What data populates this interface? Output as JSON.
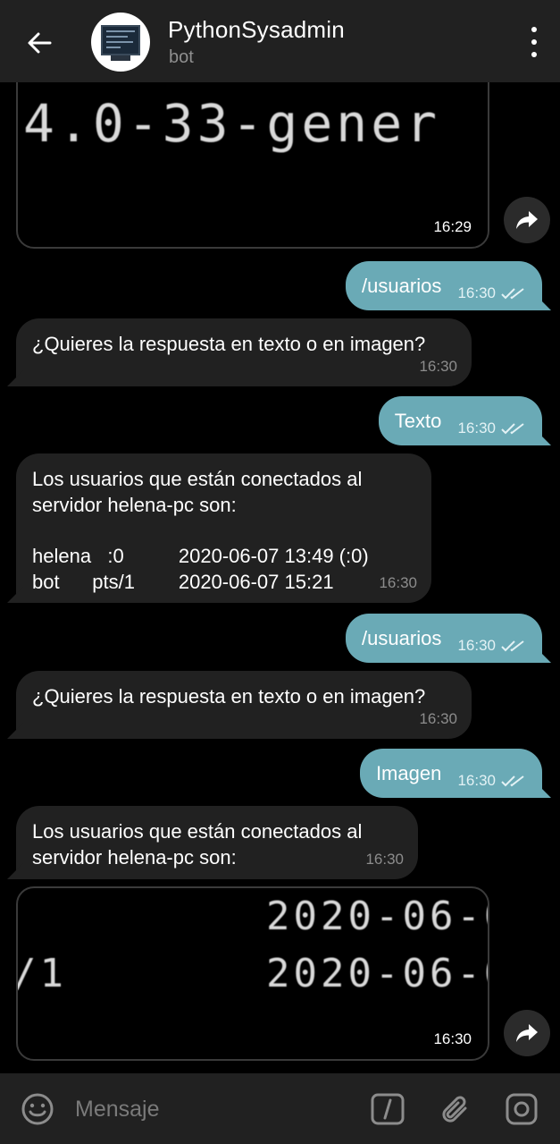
{
  "header": {
    "title": "PythonSysadmin",
    "subtitle": "bot"
  },
  "messages": {
    "photo1": {
      "text": "4.0-33-gener",
      "time": "16:29"
    },
    "out1": {
      "text": "/usuarios",
      "time": "16:30"
    },
    "in1": {
      "text": "¿Quieres la respuesta en texto o en imagen?",
      "time": "16:30"
    },
    "out2": {
      "text": "Texto",
      "time": "16:30"
    },
    "in2": {
      "line1": "Los usuarios que están conectados al",
      "line2": "servidor helena-pc son:",
      "row1": "helena   :0          2020-06-07 13:49 (:0)",
      "row2": "bot      pts/1        2020-06-07 15:21",
      "time": "16:30"
    },
    "out3": {
      "text": "/usuarios",
      "time": "16:30"
    },
    "in3": {
      "text": "¿Quieres la respuesta en texto o en imagen?",
      "time": "16:30"
    },
    "out4": {
      "text": "Imagen",
      "time": "16:30"
    },
    "in4": {
      "line1": "Los usuarios que están conectados al",
      "line2": "servidor helena-pc son:",
      "time": "16:30"
    },
    "photo2": {
      "text1": "2020-06-0",
      "text2": "/1",
      "text3": "2020-06-0",
      "time": "16:30"
    }
  },
  "composer": {
    "placeholder": "Mensaje"
  },
  "colors": {
    "outgoing": "#6aaab6",
    "incoming": "#212121",
    "header": "#212121"
  }
}
